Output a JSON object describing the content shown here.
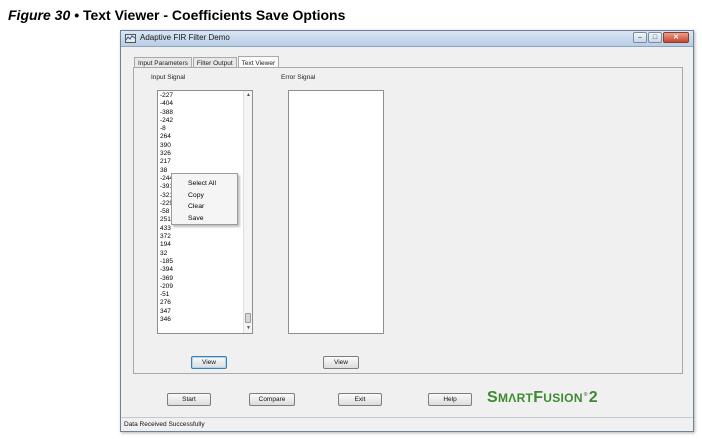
{
  "caption": {
    "figure": "Figure 30 •",
    "text": "Text Viewer - Coefficients Save Options"
  },
  "window": {
    "title": "Adaptive FIR Filter Demo",
    "controls": {
      "minimize": "–",
      "maximize": "□",
      "close": "✕"
    }
  },
  "tabs": [
    {
      "label": "Input Parameters"
    },
    {
      "label": "Filter Output"
    },
    {
      "label": "Text Viewer",
      "active": true
    }
  ],
  "input_signal": {
    "label": "Input Signal",
    "values": [
      "-227",
      "-404",
      "-388",
      "-242",
      "-8",
      "264",
      "390",
      "326",
      "217",
      "38",
      "-244",
      "-391",
      "-321",
      "-229",
      "-58",
      "251",
      "433",
      "372",
      "194",
      "32",
      "-185",
      "-394",
      "-369",
      "-209",
      "-51",
      "276",
      "347",
      "346"
    ],
    "view_button": "View"
  },
  "error_signal": {
    "label": "Error Signal",
    "view_button": "View"
  },
  "context_menu": {
    "items": [
      "Select All",
      "Copy",
      "Clear",
      "Save"
    ]
  },
  "bottom_buttons": {
    "start": "Start",
    "compare": "Compare",
    "exit": "Exit",
    "help": "Help"
  },
  "logo": {
    "part1": "S",
    "part2": "M",
    "part3": "RT",
    "part4": "F",
    "part5": "USION",
    "part6": "2",
    "color": "#3d8b2f"
  },
  "status": {
    "text": "Data Received Successfully"
  },
  "icons": {
    "app": "app-icon",
    "scroll_up": "scroll-up-icon",
    "scroll_down": "scroll-down-icon"
  }
}
